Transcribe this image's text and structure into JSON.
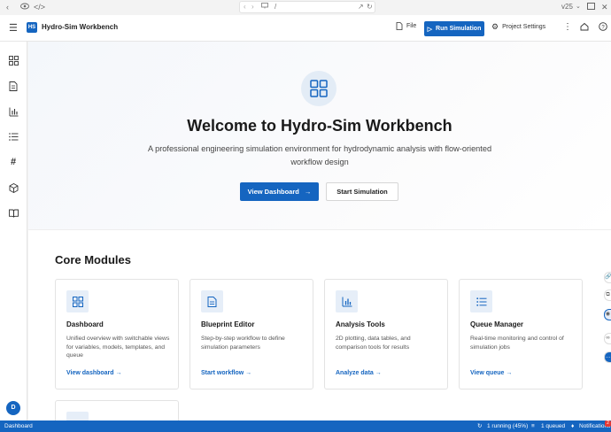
{
  "browser": {
    "url": "/",
    "version": "v25"
  },
  "header": {
    "logo": "HS",
    "title": "Hydro-Sim Workbench",
    "file_label": "File",
    "run_label": "Run Simulation",
    "settings_label": "Project Settings"
  },
  "sidebar": {
    "items": [
      {
        "icon": "dashboard-grid-icon"
      },
      {
        "icon": "document-icon"
      },
      {
        "icon": "bar-chart-icon"
      },
      {
        "icon": "list-icon"
      },
      {
        "icon": "hash-icon"
      },
      {
        "icon": "cube-icon"
      },
      {
        "icon": "book-icon"
      }
    ],
    "avatar": "D"
  },
  "hero": {
    "title": "Welcome to Hydro-Sim Workbench",
    "subtitle": "A professional engineering simulation environment for hydrodynamic analysis with flow-oriented workflow design",
    "primary_button": "View Dashboard",
    "secondary_button": "Start Simulation"
  },
  "modules": {
    "title": "Core Modules",
    "cards": [
      {
        "icon": "dashboard-grid-icon",
        "title": "Dashboard",
        "description": "Unified overview with switchable views for variables, models, templates, and queue",
        "link": "View dashboard"
      },
      {
        "icon": "document-icon",
        "title": "Blueprint Editor",
        "description": "Step-by-step workflow to define simulation parameters",
        "link": "Start workflow"
      },
      {
        "icon": "bar-chart-icon",
        "title": "Analysis Tools",
        "description": "2D plotting, data tables, and comparison tools for results",
        "link": "Analyze data"
      },
      {
        "icon": "list-icon",
        "title": "Queue Manager",
        "description": "Real-time monitoring and control of simulation jobs",
        "link": "View queue"
      }
    ]
  },
  "statusbar": {
    "left": "Dashboard",
    "running": "1 running (45%)",
    "queued": "1 queued",
    "notifications": "Notifications",
    "notif_count": "2"
  },
  "colors": {
    "accent": "#1565c0",
    "icon_bg": "#e6eef8",
    "status_bar": "#1565c0"
  }
}
